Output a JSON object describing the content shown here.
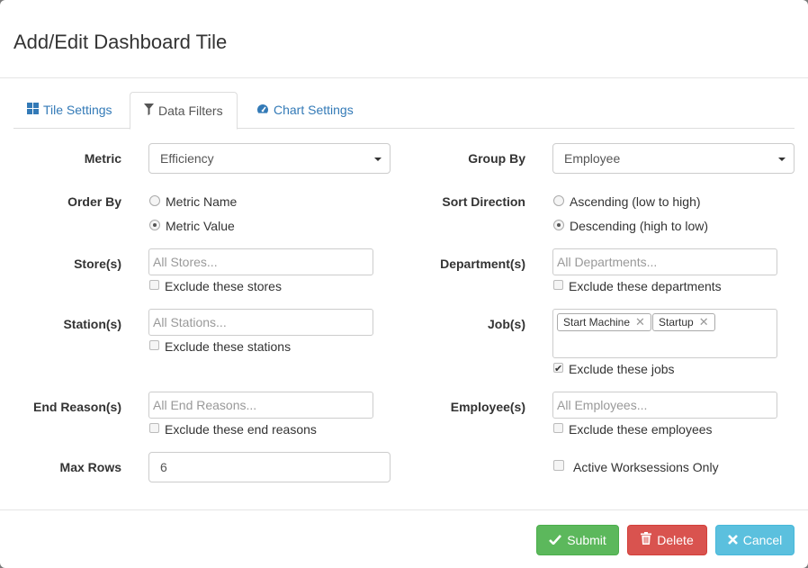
{
  "modal": {
    "title": "Add/Edit Dashboard Tile"
  },
  "tabs": [
    {
      "label": "Tile Settings",
      "icon": "grid-icon",
      "active": false
    },
    {
      "label": "Data Filters",
      "icon": "filter-icon",
      "active": true
    },
    {
      "label": "Chart Settings",
      "icon": "dashboard-gauge-icon",
      "active": false
    }
  ],
  "form": {
    "metric": {
      "label": "Metric",
      "value": "Efficiency"
    },
    "group_by": {
      "label": "Group By",
      "value": "Employee"
    },
    "order_by": {
      "label": "Order By",
      "options": [
        "Metric Name",
        "Metric Value"
      ],
      "selected": "Metric Value"
    },
    "sort_direction": {
      "label": "Sort Direction",
      "options": [
        "Ascending (low to high)",
        "Descending (high to low)"
      ],
      "selected": "Descending (high to low)"
    },
    "stores": {
      "label": "Store(s)",
      "placeholder": "All Stores...",
      "exclude_label": "Exclude these stores",
      "exclude_checked": false
    },
    "departments": {
      "label": "Department(s)",
      "placeholder": "All Departments...",
      "exclude_label": "Exclude these departments",
      "exclude_checked": false
    },
    "stations": {
      "label": "Station(s)",
      "placeholder": "All Stations...",
      "exclude_label": "Exclude these stations",
      "exclude_checked": false
    },
    "jobs": {
      "label": "Job(s)",
      "tags": [
        "Start Machine",
        "Startup"
      ],
      "exclude_label": "Exclude these jobs",
      "exclude_checked": true
    },
    "end_reasons": {
      "label": "End Reason(s)",
      "placeholder": "All End Reasons...",
      "exclude_label": "Exclude these end reasons",
      "exclude_checked": false
    },
    "employees": {
      "label": "Employee(s)",
      "placeholder": "All Employees...",
      "exclude_label": "Exclude these employees",
      "exclude_checked": false
    },
    "max_rows": {
      "label": "Max Rows",
      "value": "6"
    },
    "active_worksessions": {
      "label": "Active Worksessions Only",
      "checked": false
    }
  },
  "footer": {
    "submit_label": "Submit",
    "delete_label": "Delete",
    "cancel_label": "Cancel"
  },
  "colors": {
    "link": "#337ab7",
    "success": "#5cb85c",
    "danger": "#d9534f",
    "info": "#5bc0de"
  }
}
